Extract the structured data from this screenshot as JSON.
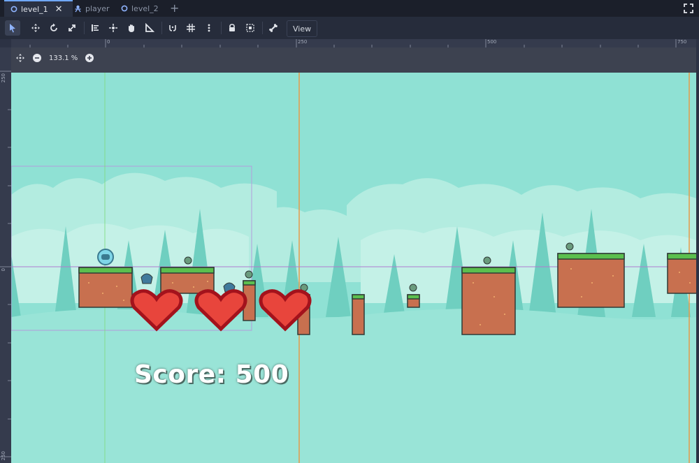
{
  "tabs": [
    {
      "label": "level_1",
      "icon": "scene-circle-icon",
      "active": true
    },
    {
      "label": "player",
      "icon": "node-person-icon",
      "active": false
    },
    {
      "label": "level_2",
      "icon": "scene-circle-icon",
      "active": false
    }
  ],
  "toolbar": {
    "view_label": "View"
  },
  "viewport": {
    "zoom": "133.1 %",
    "ruler_top": [
      "0",
      "250",
      "500",
      "750"
    ],
    "ruler_left": [
      "250",
      "0",
      "250"
    ]
  },
  "scene": {
    "score_text": "Score: 500",
    "colors": {
      "sky": "#8fe1d4",
      "grass": "#5bbf4e",
      "dirt": "#c8704f",
      "heart": "#e8453c",
      "heart_border": "#a3121c"
    }
  }
}
